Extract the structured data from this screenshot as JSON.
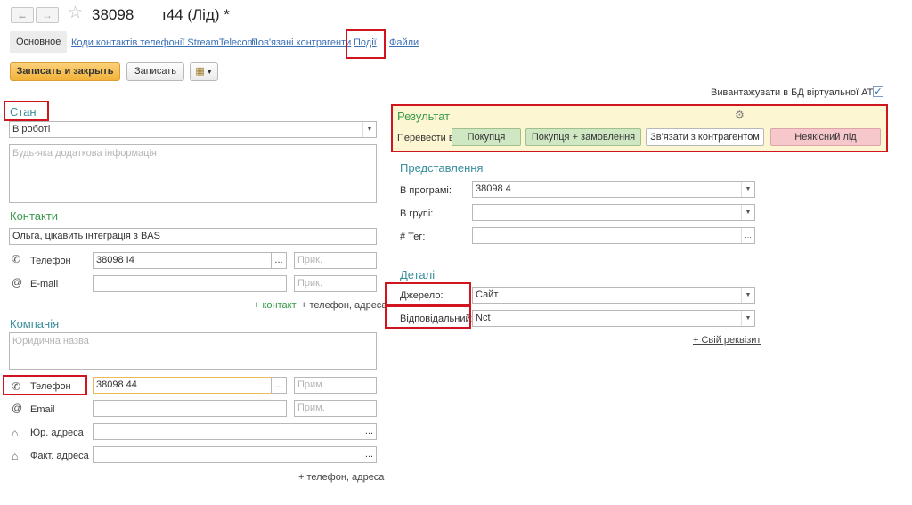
{
  "header": {
    "back_icon": "arrow-left-icon",
    "forward_icon": "arrow-right-icon",
    "star_icon": "star-icon",
    "title_part1": "38098",
    "title_part2": "ı44 (Лід) *"
  },
  "tabs": [
    {
      "label": "Основное"
    },
    {
      "label": "Коди контактів телефонії StreamTelecom"
    },
    {
      "label": "Пов'язані контрагенти"
    },
    {
      "label": "Події"
    },
    {
      "label": "Файли"
    }
  ],
  "toolbar": {
    "save_close": "Записать и закрыть",
    "save": "Записать",
    "more_icon": "document-clock-icon"
  },
  "left": {
    "state_title": "Стан",
    "state_value": "В роботі",
    "info_placeholder": "Будь-яка додаткова інформація",
    "contacts_title": "Контакти",
    "contact_name": "Ольга, цікавить інтеграція з BAS",
    "contact_phone_label": "Телефон",
    "contact_phone_value": "38098          I4",
    "contact_phone_note_ph": "Прик.",
    "contact_email_label": "E-mail",
    "contact_email_note_ph": "Прик.",
    "add_contact": "+ контакт",
    "add_phone_address": "+ телефон, адреса",
    "company_title": "Компанія",
    "company_name_ph": "Юридична назва",
    "company_phone_label": "Телефон",
    "company_phone_value": "38098          44",
    "company_phone_note_ph": "Прим.",
    "company_email_label": "Email",
    "company_email_note_ph": "Прим.",
    "legal_address_label": "Юр. адреса",
    "actual_address_label": "Факт. адреса",
    "company_add_phone_address": "+ телефон, адреса",
    "dots": "..."
  },
  "right": {
    "export_label": "Вивантажувати в БД віртуальної АТС:",
    "export_checked": true,
    "result_title": "Результат",
    "convert_label": "Перевести в:",
    "btn_purchase": "Покупця",
    "btn_purchase_order": "Покупця + замовлення",
    "btn_link": "Зв'язати з контрагентом",
    "btn_bad": "Неякісний лід",
    "presentation_title": "Представлення",
    "program_label": "В програмі:",
    "program_value": "38098           4",
    "group_label": "В групі:",
    "tag_label": "# Тег:",
    "details_title": "Деталі",
    "source_label": "Джерело:",
    "source_value": "Сайт",
    "responsible_label": "Відповідальний:",
    "responsible_value": "Nct",
    "own_prop": "+ Свій реквізит"
  },
  "colors": {
    "highlight_red": "#d0151f",
    "primary_orange": "#f3b23b",
    "section_teal": "#3a8f9d",
    "section_green": "#3a9a4a",
    "result_bg": "#fdf6d2",
    "btn_green": "#cfe7c2",
    "btn_pink": "#f6c8cb"
  }
}
